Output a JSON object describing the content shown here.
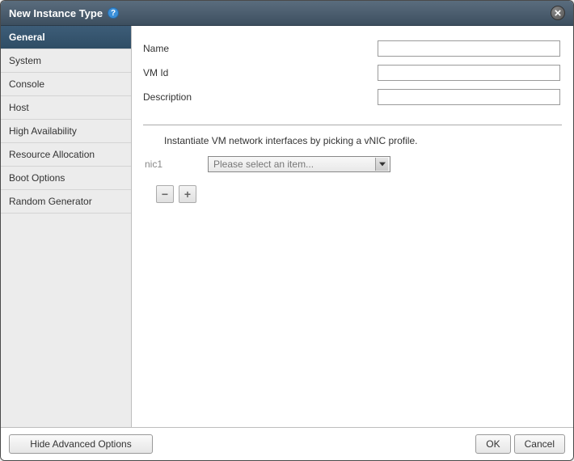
{
  "titlebar": {
    "title": "New Instance Type",
    "help_glyph": "?"
  },
  "sidebar": {
    "items": [
      {
        "label": "General",
        "active": true
      },
      {
        "label": "System",
        "active": false
      },
      {
        "label": "Console",
        "active": false
      },
      {
        "label": "Host",
        "active": false
      },
      {
        "label": "High Availability",
        "active": false
      },
      {
        "label": "Resource Allocation",
        "active": false
      },
      {
        "label": "Boot Options",
        "active": false
      },
      {
        "label": "Random Generator",
        "active": false
      }
    ]
  },
  "form": {
    "name_label": "Name",
    "name_value": "",
    "vmid_label": "VM Id",
    "vmid_value": "",
    "description_label": "Description",
    "description_value": ""
  },
  "nic": {
    "hint": "Instantiate VM network interfaces by picking a vNIC profile.",
    "label": "nic1",
    "placeholder": "Please select an item...",
    "remove_glyph": "−",
    "add_glyph": "+"
  },
  "footer": {
    "advanced_label": "Hide Advanced Options",
    "ok_label": "OK",
    "cancel_label": "Cancel"
  }
}
